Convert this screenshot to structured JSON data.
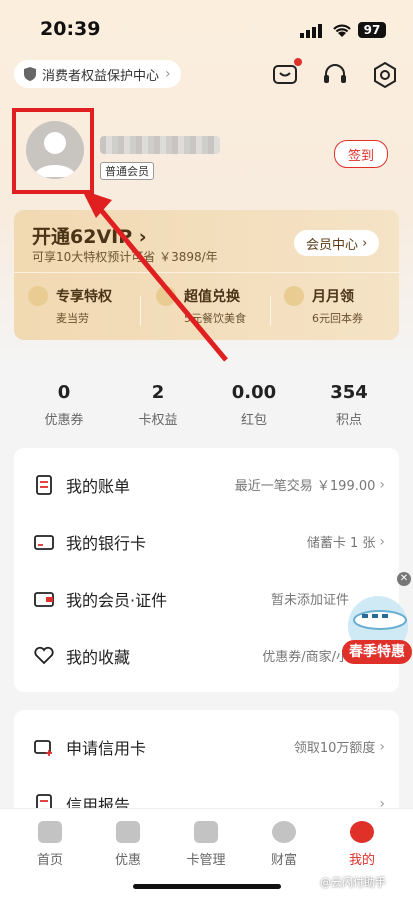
{
  "status": {
    "time": "20:39",
    "battery": "97"
  },
  "header": {
    "consumer_center": "消费者权益保护中心"
  },
  "profile": {
    "member_level": "普通会员",
    "signin": "签到"
  },
  "vip": {
    "title": "开通62VIP",
    "subtitle": "可享10大特权预计可省 ￥3898/年",
    "center_button": "会员中心",
    "perks": [
      {
        "title": "专享特权",
        "sub": "麦当劳"
      },
      {
        "title": "超值兑换",
        "sub": "5元餐饮美食"
      },
      {
        "title": "月月领",
        "sub": "6元回本券"
      }
    ]
  },
  "stats": [
    {
      "value": "0",
      "label": "优惠券"
    },
    {
      "value": "2",
      "label": "卡权益"
    },
    {
      "value": "0.00",
      "label": "红包"
    },
    {
      "value": "354",
      "label": "积点"
    }
  ],
  "menu1": [
    {
      "label": "我的账单",
      "right": "最近一笔交易 ￥199.00"
    },
    {
      "label": "我的银行卡",
      "right": "储蓄卡 1 张"
    },
    {
      "label": "我的会员·证件",
      "right": "暂未添加证件"
    },
    {
      "label": "我的收藏",
      "right": "优惠券/商家/小"
    }
  ],
  "menu2": [
    {
      "label": "申请信用卡",
      "right": "领取10万额度"
    },
    {
      "label": "信用报告",
      "right": ""
    }
  ],
  "promo": {
    "label": "春季特惠"
  },
  "tabs": [
    {
      "label": "首页"
    },
    {
      "label": "优惠"
    },
    {
      "label": "卡管理"
    },
    {
      "label": "财富"
    },
    {
      "label": "我的"
    }
  ],
  "watermark": "@云闪付助手",
  "colors": {
    "accent": "#e0302a",
    "vip_gold": "#f1d9b2"
  }
}
